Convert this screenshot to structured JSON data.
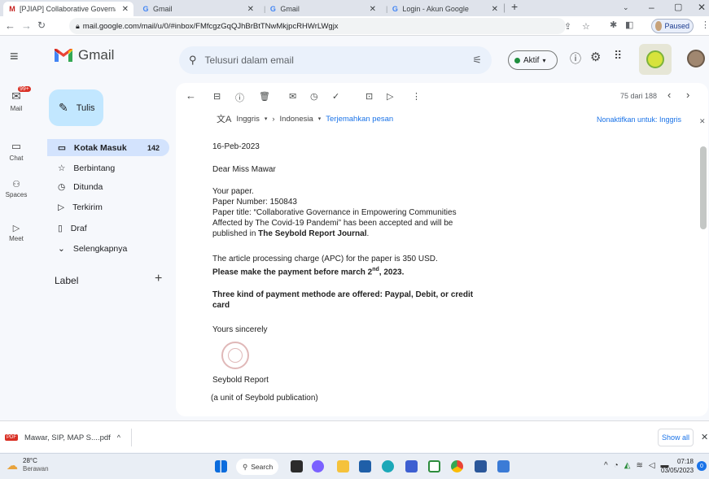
{
  "browser": {
    "tabs": [
      {
        "title": "[PJIAP] Collaborative Governance",
        "icon": "gmail-icon"
      },
      {
        "title": "Gmail",
        "icon": "google-icon"
      },
      {
        "title": "Gmail",
        "icon": "google-icon"
      },
      {
        "title": "Login - Akun Google",
        "icon": "google-icon"
      }
    ],
    "url": "mail.google.com/mail/u/0/#inbox/FMfcgzGqQJhBrBtTNwMkjpcRHWrLWgjx",
    "profile_status": "Paused"
  },
  "gmail": {
    "logo": "Gmail",
    "search_placeholder": "Telusuri dalam email",
    "status": "Aktif",
    "compose": "Tulis",
    "rail": [
      "Mail",
      "Chat",
      "Spaces",
      "Meet"
    ],
    "mail_badge": "99+",
    "nav": [
      {
        "label": "Kotak Masuk",
        "count": "142",
        "icon": "inbox-icon"
      },
      {
        "label": "Berbintang",
        "icon": "star-icon"
      },
      {
        "label": "Ditunda",
        "icon": "clock-icon"
      },
      {
        "label": "Terkirim",
        "icon": "send-icon"
      },
      {
        "label": "Draf",
        "icon": "draft-icon"
      },
      {
        "label": "Selengkapnya",
        "icon": "chevron-down-icon"
      }
    ],
    "label_heading": "Label"
  },
  "message": {
    "pager": "75 dari 188",
    "translate": {
      "from": "Inggris",
      "to": "Indonesia",
      "action": "Terjemahkan pesan",
      "disable": "Nonaktifkan untuk: Inggris"
    },
    "date": "16-Peb-2023",
    "greeting": "Dear Miss Mawar",
    "intro": "Your paper.",
    "paper_number": "Paper Number: 150843",
    "title_line1": "Paper title: “Collaborative Governance in Empowering Communities",
    "title_line2": "Affected by The Covid-19 Pandemi” has been accepted and will be",
    "title_line3_prefix": "published in ",
    "journal": "The Seybold Report Journal",
    "title_line3_suffix": ".",
    "apc": "The article processing charge (APC) for the paper is 350 USD.",
    "deadline_prefix": "Please make the payment before march 2",
    "deadline_sup": "nd",
    "deadline_suffix": ", 2023.",
    "payment_line1": "Three kind of payment methode are offered: Paypal, Debit, or credit",
    "payment_line2": "card",
    "closing": "Yours sincerely",
    "sender": "Seybold Report",
    "sender_note": "(a unit of Seybold publication)"
  },
  "download": {
    "filename": "Mawar, SIP, MAP S....pdf",
    "show_all": "Show all"
  },
  "taskbar": {
    "weather_temp": "28°C",
    "weather_desc": "Berawan",
    "search": "Search",
    "time": "07:18",
    "date": "03/05/2023"
  }
}
